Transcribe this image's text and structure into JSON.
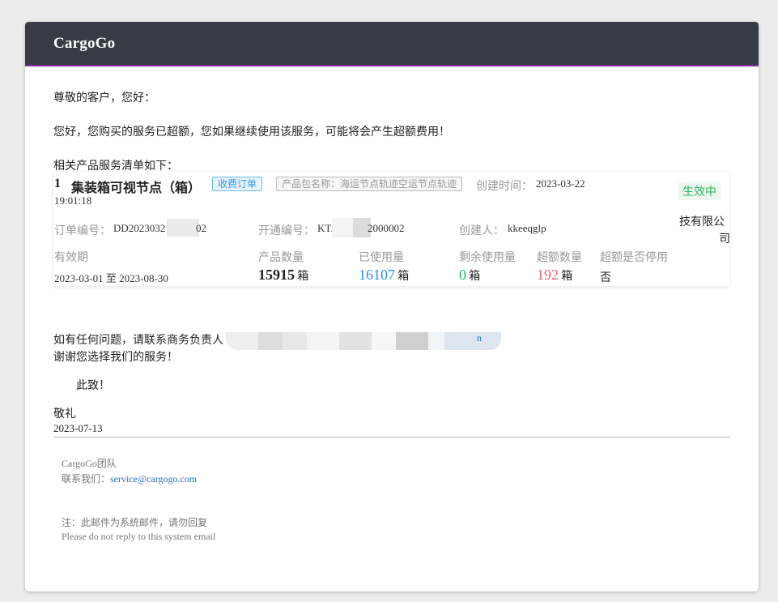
{
  "brand": "CargoGo",
  "greeting": "尊敬的客户，您好：",
  "notice": "您好，您购买的服务已超额，您如果继续使用该服务，可能将会产生超额费用！",
  "list_intro": "相关产品服务清单如下：",
  "order": {
    "index": "1",
    "name": "集装箱可视节点（箱）",
    "tag_paid": "收费订单",
    "package_tag": "产品包名称：海运节点轨迹空运节点轨迹",
    "created_label": "创建时间：",
    "created_date": "2023-03-22",
    "created_time": "19:01:18",
    "status": "生效中",
    "order_no_label": "订单编号：",
    "order_no_value": "DD2023032",
    "order_no_tail": "02",
    "open_no_label": "开通编号：",
    "open_no_value": "KT.",
    "open_no_tail": "2000002",
    "creator_label": "创建人：",
    "creator_value": "kkeeqglp",
    "company_line1": "技有限公",
    "company_line2": "司",
    "validity_label": "有效期",
    "validity_value": "2023-03-01 至 2023-08-30",
    "qty_label": "产品数量",
    "qty_value": "15915",
    "used_label": "已使用量",
    "used_value": "16107",
    "remain_label": "剩余使用量",
    "remain_value": "0",
    "over_label": "超额数量",
    "over_value": "192",
    "stopped_label": "超额是否停用",
    "stopped_value": "否",
    "unit": "箱"
  },
  "contact_line": "如有任何问题，请联系商务负责人",
  "contact_tail": "n",
  "thanks": "谢谢您选择我们的服务！",
  "regards": "此致！",
  "salute": "敬礼",
  "date": "2023-07-13",
  "footer": {
    "team": "CargoGo团队",
    "contact_label": "联系我们：",
    "email": "service@cargogo.com",
    "note_cn": "注：此邮件为系统邮件，请勿回复",
    "note_en": "Please do not reply to this system email"
  },
  "colors": {
    "header_bg": "#383a45",
    "accent": "#8a2e9e",
    "used_blue": "#2e8fe0",
    "remain_green": "#2ab860",
    "over_red": "#e9606f"
  }
}
